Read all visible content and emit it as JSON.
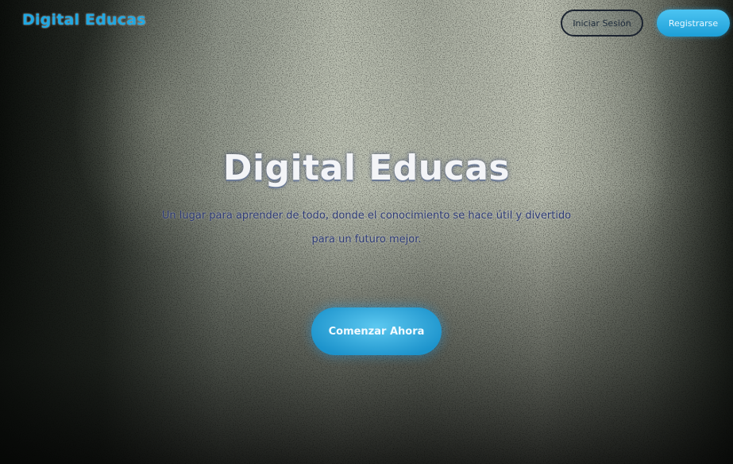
{
  "header": {
    "brand": "Digital Educas",
    "login_label": "Iniciar Sesión",
    "register_label": "Registrarse"
  },
  "hero": {
    "title": "Digital Educas",
    "subtitle": "Un lugar para aprender de todo, donde el conocimiento se hace útil y divertido para un futuro mejor.",
    "cta_label": "Comenzar Ahora"
  },
  "colors": {
    "accent": "#1fa8e3",
    "cta": "#2aa7df",
    "subtitle": "#2e3b76"
  }
}
